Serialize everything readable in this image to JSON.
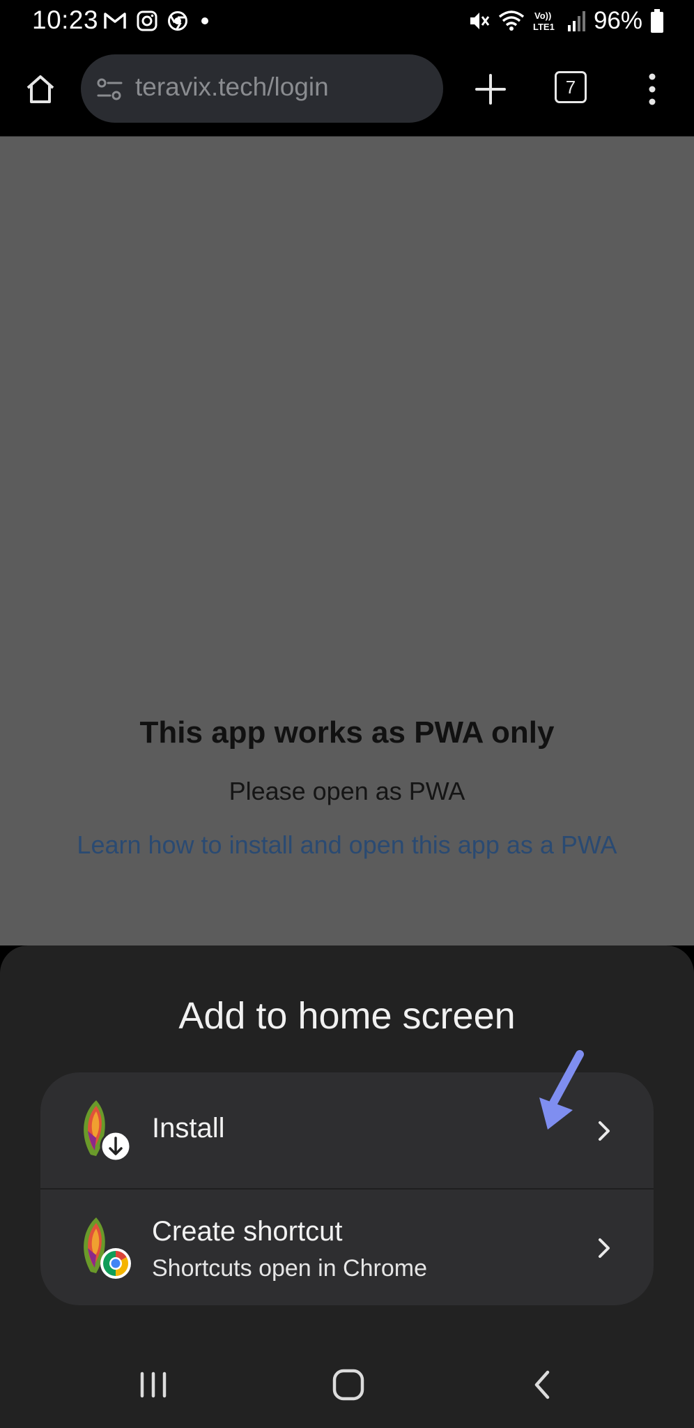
{
  "status_bar": {
    "time": "10:23",
    "notification_icons": [
      "gmail-icon",
      "instagram-icon",
      "chrome-icon",
      "dot-icon"
    ],
    "system_icons": [
      "mute-icon",
      "wifi-icon",
      "volte-icon",
      "signal-icon"
    ],
    "volte_label": "Vo)) LTE1",
    "battery": "96%"
  },
  "browser": {
    "url": "teravix.tech/login",
    "tab_count": "7"
  },
  "page": {
    "title": "This app works as PWA only",
    "subtitle": "Please open as PWA",
    "link": "Learn how to install and open this app as a PWA"
  },
  "sheet": {
    "title": "Add to home screen",
    "options": [
      {
        "label": "Install",
        "icon": "app-install-icon"
      },
      {
        "label": "Create shortcut",
        "sublabel": "Shortcuts open in Chrome",
        "icon": "app-shortcut-icon"
      }
    ]
  },
  "colors": {
    "annotation_arrow": "#7f8ef0",
    "page_link": "#2a4a72",
    "sheet_bg": "#222222",
    "card_bg": "#2e2e30"
  }
}
